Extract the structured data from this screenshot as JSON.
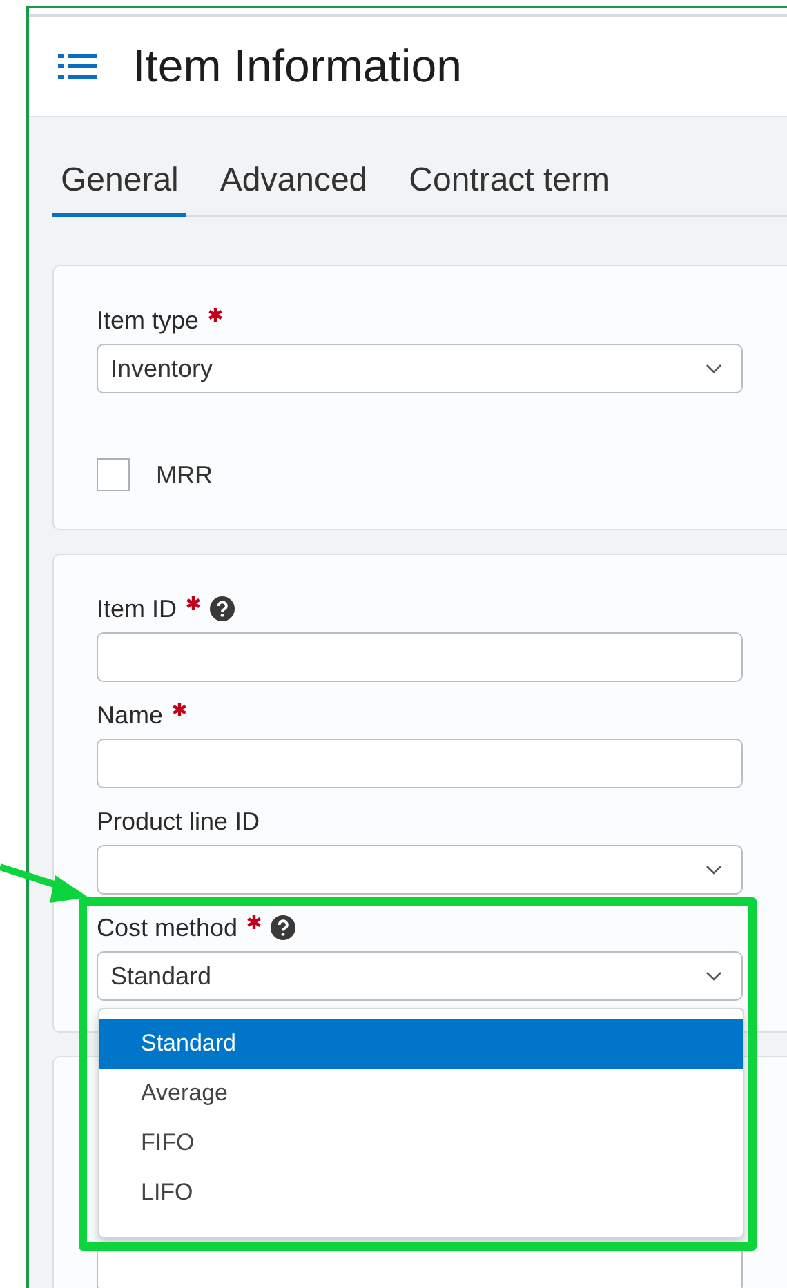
{
  "header": {
    "title": "Item Information"
  },
  "tabs": [
    {
      "label": "General",
      "selected": true
    },
    {
      "label": "Advanced",
      "selected": false
    },
    {
      "label": "Contract term",
      "selected": false
    }
  ],
  "sections": [
    {
      "fields": [
        {
          "kind": "select",
          "label": "Item type",
          "required": true,
          "help": false,
          "value": "Inventory"
        },
        {
          "kind": "checkbox",
          "label": "MRR",
          "checked": false
        }
      ]
    },
    {
      "fields": [
        {
          "kind": "text",
          "label": "Item ID",
          "required": true,
          "help": true
        },
        {
          "kind": "text",
          "label": "Name",
          "required": true,
          "help": false
        },
        {
          "kind": "select",
          "label": "Product line ID",
          "required": false,
          "help": false
        },
        {
          "kind": "select",
          "label": "Cost method",
          "required": true,
          "help": true,
          "value": "Standard",
          "options": [
            {
              "label": "Standard",
              "selected": true
            },
            {
              "label": "Average",
              "selected": false
            },
            {
              "label": "FIFO",
              "selected": false
            },
            {
              "label": "LIFO",
              "selected": false
            }
          ]
        }
      ]
    },
    {
      "fields": [
        {
          "kind": "text"
        }
      ]
    }
  ]
}
